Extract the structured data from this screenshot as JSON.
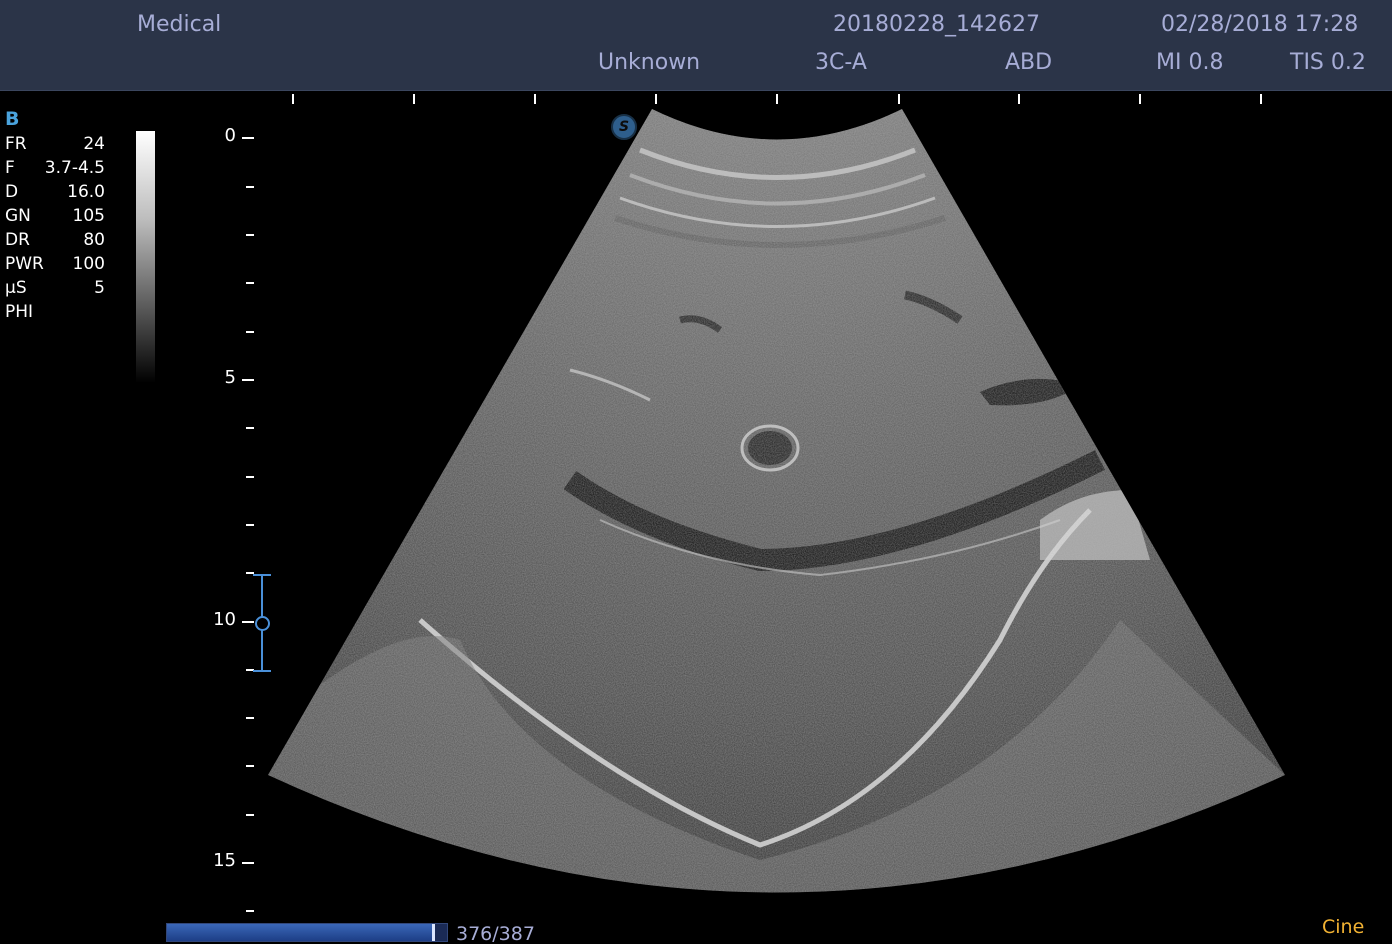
{
  "header": {
    "institution": "Medical",
    "exam_id": "20180228_142627",
    "datetime": "02/28/2018 17:28",
    "patient": "Unknown",
    "probe": "3C-A",
    "preset": "ABD",
    "mi": "MI 0.8",
    "tis": "TIS 0.2"
  },
  "params": {
    "mode": "B",
    "rows": [
      {
        "key": "FR",
        "value": "24"
      },
      {
        "key": "F",
        "value": "3.7-4.5"
      },
      {
        "key": "D",
        "value": "16.0"
      },
      {
        "key": "GN",
        "value": "105"
      },
      {
        "key": "DR",
        "value": "80"
      },
      {
        "key": "PWR",
        "value": "100"
      },
      {
        "key": "µS",
        "value": "5"
      },
      {
        "key": "PHI",
        "value": ""
      }
    ]
  },
  "depth_scale": {
    "labels": [
      "0",
      "5",
      "10",
      "15"
    ],
    "max_depth": 16
  },
  "focus": {
    "depth": 10
  },
  "orientation_marker": "S",
  "cine": {
    "current": 376,
    "total": 387,
    "counter": "376/387",
    "mode": "Cine"
  },
  "colors": {
    "header_bg": "#2b3448",
    "header_text": "#a7add6",
    "accent_blue": "#4a90d9",
    "cine_text": "#f2b233"
  },
  "icons": {
    "orientation": "s-circle-icon",
    "focus": "focus-marker-icon"
  }
}
